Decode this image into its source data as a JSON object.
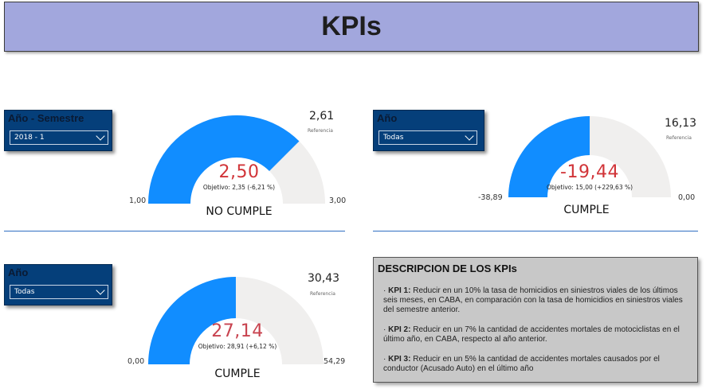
{
  "header": {
    "title": "KPIs"
  },
  "kpi1": {
    "slicer_title": "Año - Semestre",
    "slicer_value": "2018 - 1",
    "value": "2,50",
    "target": "Objetivo: 2,35 (-6,21 %)",
    "min": "1,00",
    "max": "3,00",
    "reference_value": "2,61",
    "reference_label": "Referencia",
    "status": "NO CUMPLE",
    "gauge": {
      "min": 1.0,
      "max": 3.0,
      "value": 2.5
    },
    "value_color": "#d13438"
  },
  "kpi2": {
    "slicer_title": "Año",
    "slicer_value": "Todas",
    "value": "-19,44",
    "target": "Objetivo: 15,00 (+229,63 %)",
    "min": "-38,89",
    "max": "0,00",
    "reference_value": "16,13",
    "reference_label": "Referencia",
    "status": "CUMPLE",
    "gauge": {
      "min": -38.89,
      "max": 0.0,
      "value": -19.44
    },
    "value_color": "#d13438"
  },
  "kpi3": {
    "slicer_title": "Año",
    "slicer_value": "Todas",
    "value": "27,14",
    "target": "Objetivo: 28,91 (+6,12 %)",
    "min": "0,00",
    "max": "54,29",
    "reference_value": "30,43",
    "reference_label": "Referencia",
    "status": "CUMPLE",
    "gauge": {
      "min": 0.0,
      "max": 54.29,
      "value": 27.14
    },
    "value_color": "#c8434f"
  },
  "description": {
    "title": "DESCRIPCION DE LOS KPIs",
    "items": [
      {
        "label": "KPI 1:",
        "text": " Reducir en un 10% la tasa de homicidios en siniestros viales de los últimos seis meses, en CABA, en comparación con la tasa de homicidios en siniestros viales del semestre anterior."
      },
      {
        "label": "KPI 2:",
        "text": " Reducir en un 7% la cantidad de accidentes mortales de motociclistas en el último año, en CABA, respecto al año anterior."
      },
      {
        "label": "KPI 3:",
        "text": " Reducir en un 5% la cantidad de accidentes mortales causados por el conductor (Acusado Auto) en el último año"
      }
    ]
  },
  "colors": {
    "gauge_fill": "#118dff",
    "gauge_track": "#f0efee",
    "title_bg": "#a2a7dd",
    "slicer_bg": "#053f7a",
    "divider": "#2f6fc2"
  }
}
